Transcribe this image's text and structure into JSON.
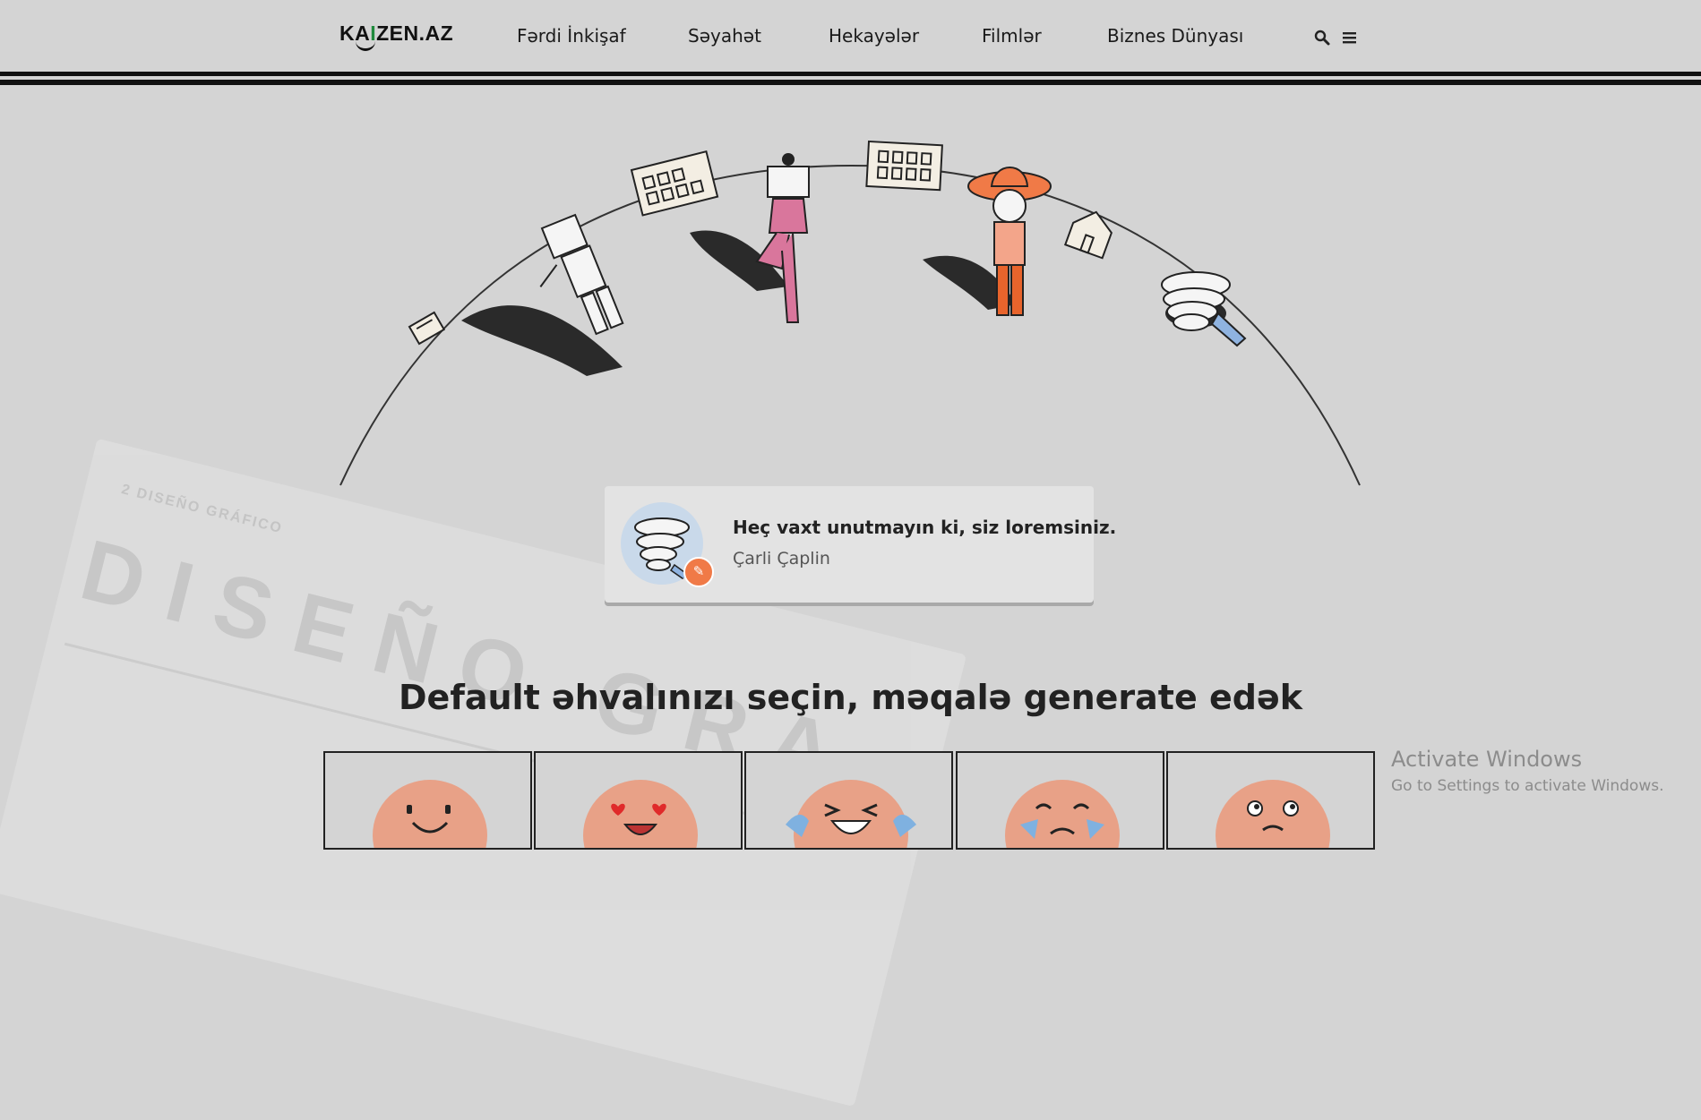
{
  "header": {
    "logo": {
      "part1": "KA",
      "part2": "I",
      "part3": "ZEN.AZ"
    },
    "nav": [
      {
        "label": "Fərdi İnkişaf"
      },
      {
        "label": "Səyahət"
      },
      {
        "label": "Hekayələr"
      },
      {
        "label": "Filmlər"
      },
      {
        "label": "Biznes Dünyası"
      }
    ],
    "icons": [
      "search-icon",
      "menu-icon"
    ]
  },
  "background": {
    "ghost_title": "2 DISEÑO GRÁFICO",
    "ghost_word": "DISEÑO GRA"
  },
  "quote": {
    "text": "Heç vaxt unutmayın ki, siz loremsiniz.",
    "author": "Çarli Çaplin",
    "badge_icon": "pencil-icon"
  },
  "moods_section": {
    "title": "Default əhvalınızı seçin, məqalə generate edək",
    "moods": [
      "smile-face",
      "heart-eyes-face",
      "laughing-tears-face",
      "crying-face",
      "thinking-face"
    ]
  },
  "colors": {
    "background": "#d4d4d4",
    "accent_orange": "#f07a47",
    "face_skin": "#e8a187",
    "logo_green": "#1f8a3c"
  },
  "watermark": {
    "title": "Activate Windows",
    "subtitle": "Go to Settings to activate Windows."
  }
}
